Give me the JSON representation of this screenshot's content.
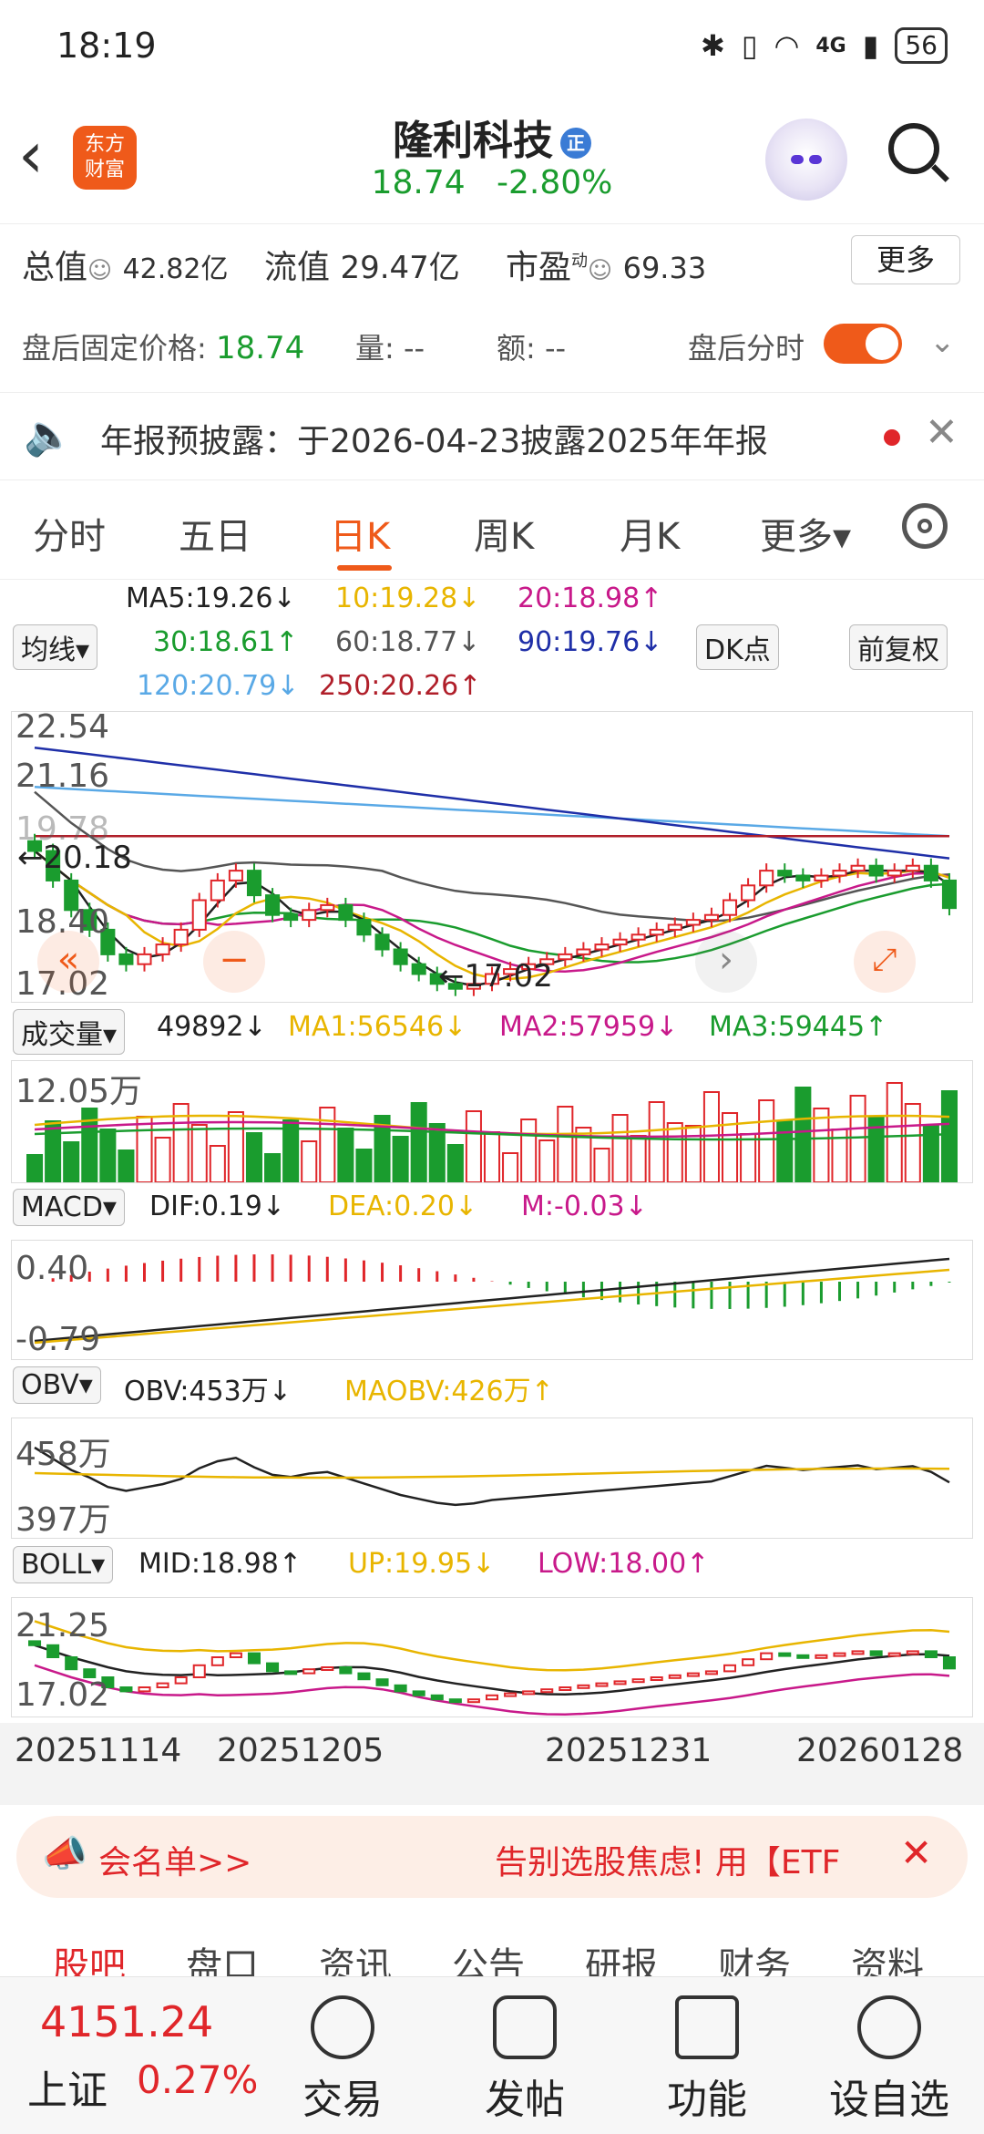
{
  "status_bar": {
    "time": "18:19",
    "battery": "56",
    "network": "4G"
  },
  "header": {
    "logo_line1": "东方",
    "logo_line2": "财富",
    "stock_name": "隆利科技",
    "badge": "正",
    "price": "18.74",
    "change_pct": "-2.80%"
  },
  "metrics": {
    "total_value_label": "总值",
    "total_value": "42.82亿",
    "float_value_label": "流值",
    "float_value": "29.47亿",
    "pe_label": "市盈",
    "pe_sup": "动",
    "pe_value": "69.33",
    "more_button": "更多"
  },
  "after_hours": {
    "price_label": "盘后固定价格:",
    "price": "18.74",
    "volume_label": "量: --",
    "amount_label": "额: --",
    "timeshare_label": "盘后分时",
    "toggle_on": true
  },
  "notice": {
    "text": "年报预披露：于2026-04-23披露2025年年报"
  },
  "tabs": [
    {
      "label": "分时"
    },
    {
      "label": "五日"
    },
    {
      "label": "日K"
    },
    {
      "label": "周K"
    },
    {
      "label": "月K"
    },
    {
      "label": "更多▾"
    }
  ],
  "ma_legend": {
    "selector": "均线▾",
    "ma5": "MA5:19.26↓",
    "ma10": "10:19.28↓",
    "ma20": "20:18.98↑",
    "ma30": "30:18.61↑",
    "ma60": "60:18.77↓",
    "ma90": "90:19.76↓",
    "ma120": "120:20.79↓",
    "ma250": "250:20.26↑",
    "dk_button": "DK点",
    "fq_button": "前复权"
  },
  "kline": {
    "y_high": "22.54",
    "y_mid": "21.16",
    "y_partial": "19.78",
    "y_low_mid": "18.40",
    "y_min": "17.02",
    "mark_high": "←20.18",
    "mark_low": "←17.02"
  },
  "volume_panel": {
    "selector": "成交量▾",
    "vol": "49892↓",
    "ma1": "MA1:56546↓",
    "ma2": "MA2:57959↓",
    "ma3": "MA3:59445↑",
    "y_top": "12.05万"
  },
  "macd_panel": {
    "selector": "MACD▾",
    "dif": "DIF:0.19↓",
    "dea": "DEA:0.20↓",
    "m": "M:-0.03↓",
    "y_top": "0.40",
    "y_bottom": "-0.79"
  },
  "obv_panel": {
    "selector": "OBV▾",
    "obv": "OBV:453万↓",
    "maobv": "MAOBV:426万↑",
    "y_top": "458万",
    "y_bottom": "397万"
  },
  "boll_panel": {
    "selector": "BOLL▾",
    "mid": "MID:18.98↑",
    "up": "UP:19.95↓",
    "low": "LOW:18.00↑",
    "y_top": "21.25",
    "y_bottom": "17.02"
  },
  "x_axis_dates": [
    "20251114",
    "20251205",
    "20251231",
    "20260128"
  ],
  "banner": {
    "left_text": "会名单>>",
    "right_text": "告别选股焦虑! 用【ETF"
  },
  "bottom_tabs": [
    {
      "label": "股吧"
    },
    {
      "label": "盘口"
    },
    {
      "label": "资讯"
    },
    {
      "label": "公告"
    },
    {
      "label": "研报"
    },
    {
      "label": "财务"
    },
    {
      "label": "资料"
    }
  ],
  "nav": {
    "index_value": "4151.24",
    "index_name": "上证",
    "index_change": "0.27%",
    "items": [
      {
        "label": "交易"
      },
      {
        "label": "发帖"
      },
      {
        "label": "功能"
      },
      {
        "label": "设自选"
      }
    ]
  },
  "colors": {
    "accent": "#ef5a1a",
    "up": "#e0262a",
    "down": "#1a9c2e",
    "ma5": "#222222",
    "ma10": "#e8b500",
    "ma20": "#c8198a",
    "ma30": "#1a9c2e",
    "ma60": "#555555",
    "ma90": "#1f2fa8",
    "ma120": "#5aa9e6",
    "ma250": "#b01f2a"
  },
  "chart_data": {
    "type": "candlestick",
    "close_prices": [
      19.9,
      19.3,
      18.7,
      18.3,
      17.8,
      17.6,
      17.8,
      18.0,
      18.3,
      18.9,
      19.3,
      19.5,
      19.0,
      18.6,
      18.5,
      18.7,
      18.8,
      18.5,
      18.2,
      17.9,
      17.6,
      17.4,
      17.2,
      17.1,
      17.2,
      17.4,
      17.5,
      17.6,
      17.7,
      17.8,
      17.9,
      18.0,
      18.1,
      18.2,
      18.3,
      18.4,
      18.5,
      18.6,
      18.9,
      19.2,
      19.5,
      19.4,
      19.3,
      19.4,
      19.5,
      19.6,
      19.4,
      19.5,
      19.6,
      19.3,
      18.74
    ],
    "volume_top_label": "12.05万",
    "price_range": [
      17.02,
      22.54
    ]
  }
}
